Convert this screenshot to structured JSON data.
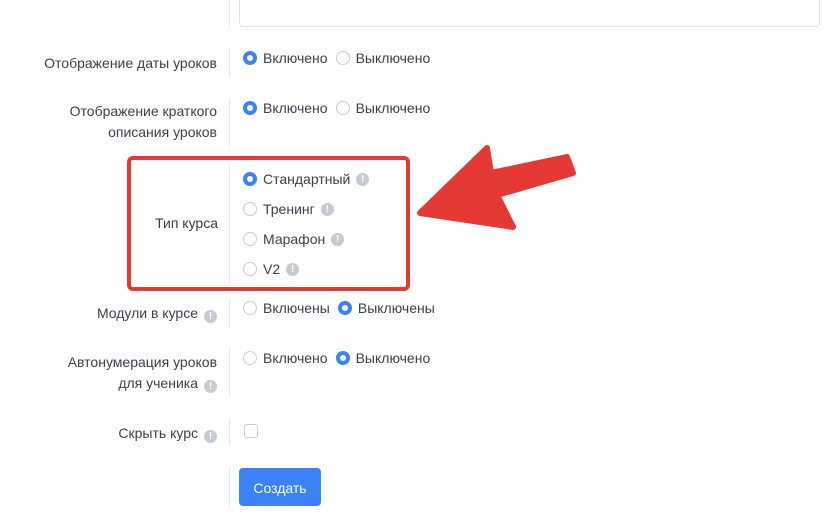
{
  "form": {
    "lesson_date": {
      "label": "Отображение даты уроков",
      "options": [
        "Включено",
        "Выключено"
      ],
      "selected": 0
    },
    "lesson_desc": {
      "label_line1": "Отображение краткого",
      "label_line2": "описания уроков",
      "options": [
        "Включено",
        "Выключено"
      ],
      "selected": 0
    },
    "course_type": {
      "label": "Тип курса",
      "options": [
        "Стандартный",
        "Тренинг",
        "Марафон",
        "V2"
      ],
      "selected": 0
    },
    "modules": {
      "label": "Модули в курсе",
      "options": [
        "Включены",
        "Выключены"
      ],
      "selected": 1
    },
    "autonumber": {
      "label_line1": "Автонумерация уроков",
      "label_line2": "для ученика",
      "options": [
        "Включено",
        "Выключено"
      ],
      "selected": 1
    },
    "hide_course": {
      "label": "Скрыть курс",
      "checked": false
    },
    "submit_label": "Создать"
  },
  "colors": {
    "accent": "#3b82f6",
    "highlight": "#e53935",
    "info_badge": "#c4c9d2"
  },
  "icons": {
    "info": "info-icon",
    "annotation": "arrow-annotation-icon"
  }
}
